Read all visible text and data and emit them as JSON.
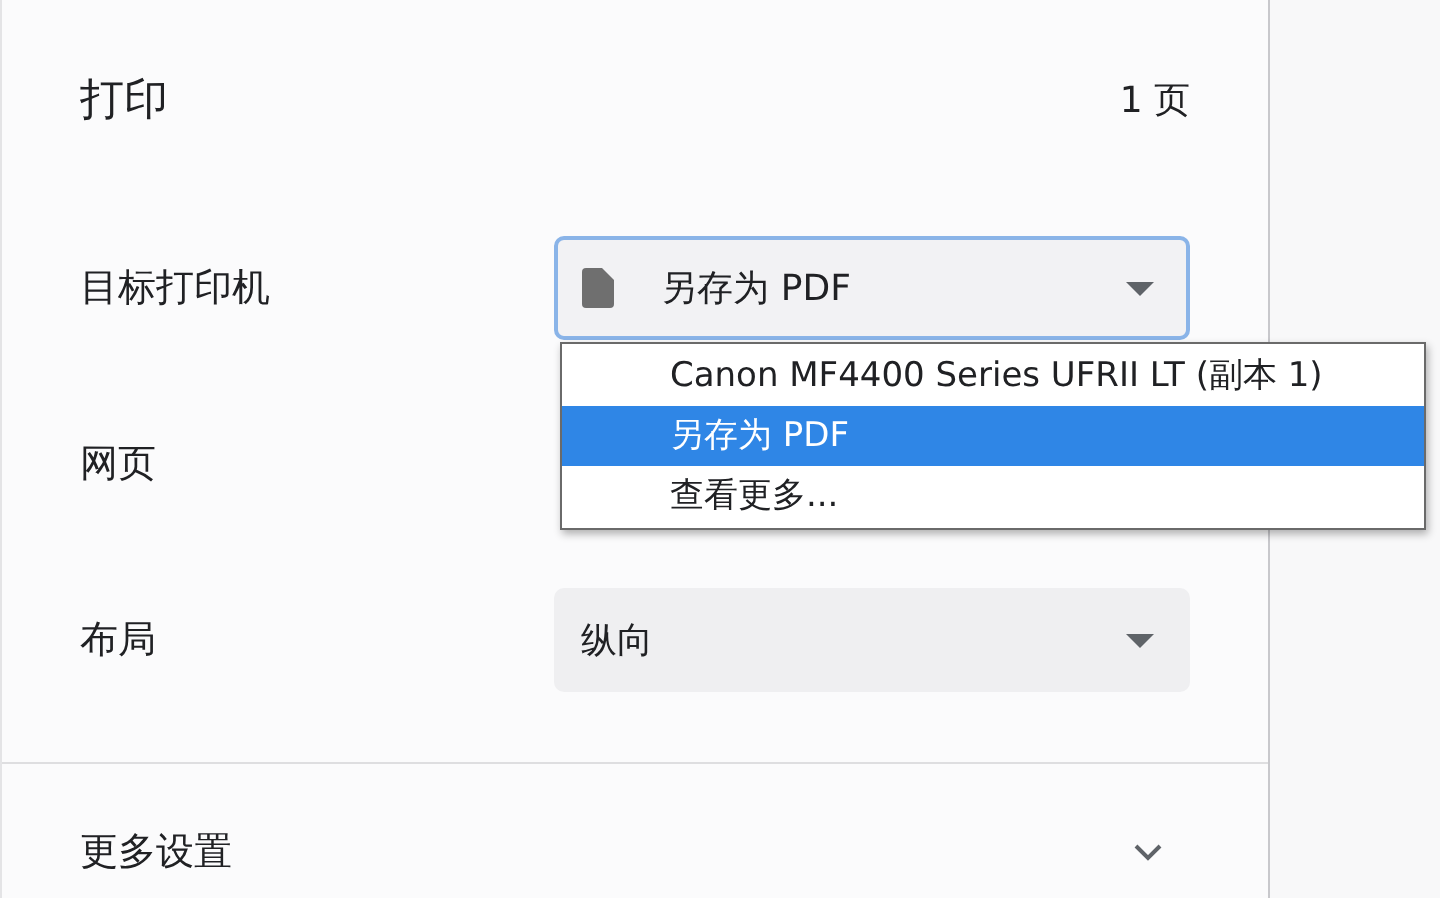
{
  "header": {
    "title": "打印",
    "page_count": "1 页"
  },
  "settings": [
    {
      "kind": "select-with-icon",
      "label": "目标打印机",
      "value": "另存为 PDF",
      "focused": true
    },
    {
      "kind": "covered",
      "label": "网页"
    },
    {
      "kind": "select",
      "label": "布局",
      "value": "纵向",
      "focused": false
    }
  ],
  "dropdown": {
    "options": [
      {
        "label": "Canon MF4400 Series UFRII LT (副本 1)",
        "selected": false
      },
      {
        "label": "另存为 PDF",
        "selected": true
      },
      {
        "label": "查看更多...",
        "selected": false
      }
    ]
  },
  "more_settings": {
    "label": "更多设置",
    "expanded": false
  }
}
